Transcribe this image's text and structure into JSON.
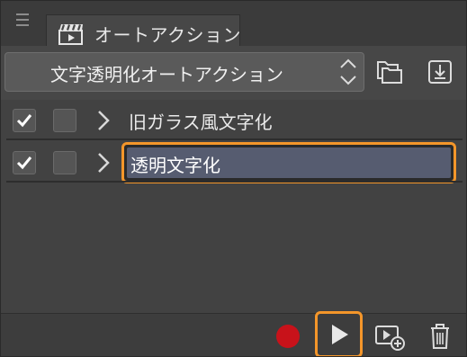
{
  "tab": {
    "title": "オートアクション",
    "icon": "clapperboard-icon"
  },
  "menu_icon": "hamburger-menu-icon",
  "set_selector": {
    "value": "文字透明化オートアクション",
    "icon": "up-down-arrows-icon"
  },
  "header_buttons": [
    {
      "icon": "folder-icon"
    },
    {
      "icon": "import-icon"
    }
  ],
  "actions": [
    {
      "label": "旧ガラス風文字化",
      "enabled": true,
      "dialog": false,
      "selected": false
    },
    {
      "label": "透明文字化",
      "enabled": true,
      "dialog": false,
      "selected": true
    }
  ],
  "toolbar": {
    "record_icon": "record-icon",
    "play_icon": "play-icon",
    "new_icon": "new-auto-action-icon",
    "delete_icon": "trash-icon"
  },
  "colors": {
    "accent": "#f4962a",
    "record": "#c8121a",
    "selected_row": "#565c70"
  }
}
